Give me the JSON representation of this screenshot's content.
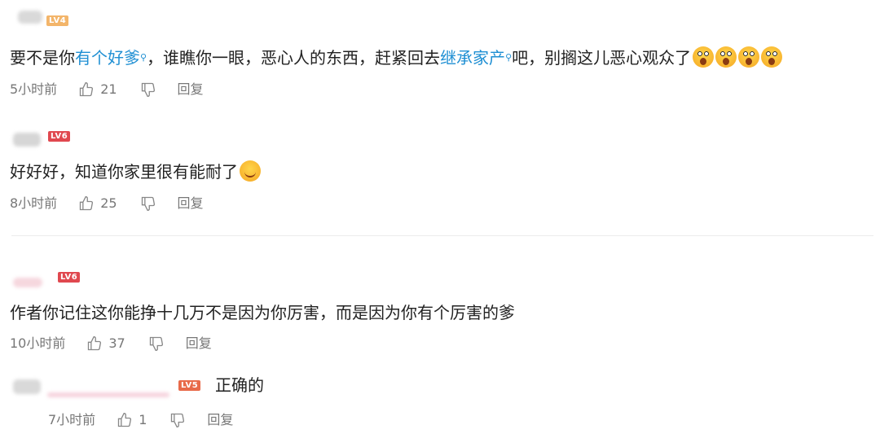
{
  "comments": [
    {
      "level": "LV4",
      "segments": [
        {
          "text": "要不是你",
          "type": "plain"
        },
        {
          "text": "有个好爹",
          "type": "link"
        },
        {
          "text": "，谁瞧你一眼，恶心人的东西，赶紧回去",
          "type": "plain"
        },
        {
          "text": "继承家产",
          "type": "link"
        },
        {
          "text": "吧，别搁这儿恶心观众了",
          "type": "plain"
        }
      ],
      "emojis": [
        "scream-face-emoji",
        "scream-face-emoji",
        "scream-face-emoji",
        "scream-face-emoji"
      ],
      "time": "5小时前",
      "likes": "21",
      "reply_label": "回复"
    },
    {
      "level": "LV6",
      "text": "好好好，知道你家里很有能耐了",
      "emojis": [
        "smile-emoji"
      ],
      "time": "8小时前",
      "likes": "25",
      "reply_label": "回复"
    },
    {
      "level": "LV6",
      "text": "作者你记住这你能挣十几万不是因为你厉害，而是因为你有个厉害的爹",
      "time": "10小时前",
      "likes": "37",
      "reply_label": "回复"
    },
    {
      "level": "LV5",
      "text": "正确的",
      "time": "7小时前",
      "likes": "1",
      "reply_label": "回复"
    }
  ],
  "colors": {
    "link": "#1f8fd3",
    "meta_text": "#777777",
    "badge_lv4": "#f3b56a",
    "badge_lv6": "#e0484f",
    "badge_lv5": "#e86a4a"
  },
  "icons": {
    "like": "thumbs-up-icon",
    "dislike": "thumbs-down-icon",
    "search_link": "search-icon"
  }
}
